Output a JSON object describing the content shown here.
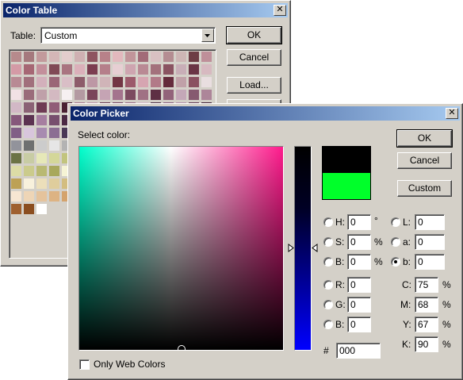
{
  "color_table": {
    "title": "Color Table",
    "table_label": "Table:",
    "table_value": "Custom",
    "buttons": {
      "ok": "OK",
      "cancel": "Cancel",
      "load": "Load..."
    },
    "swatches": [
      "#b68a8c",
      "#a5797d",
      "#c29a9c",
      "#d4b6b7",
      "#e3cdcd",
      "#cfb0b2",
      "#8e5560",
      "#b78189",
      "#e2b8bd",
      "#c1959a",
      "#a26b78",
      "#d8c0c2",
      "#b48d92",
      "#cdb6b5",
      "#6d3d45",
      "#bf8f99",
      "#d49aa6",
      "#a66774",
      "#c38f9b",
      "#804955",
      "#a97480",
      "#dbb0ba",
      "#7b3d50",
      "#b57f8a",
      "#e7cfd3",
      "#cea5b0",
      "#b98994",
      "#a3717c",
      "#8a5361",
      "#c8aeb7",
      "#6a3545",
      "#d7b9c0",
      "#b88a94",
      "#a1707c",
      "#d3b0bb",
      "#9a6677",
      "#d9bec6",
      "#8d5c6a",
      "#bd98a5",
      "#d0b4b8",
      "#733644",
      "#9c5a6b",
      "#d6a5b1",
      "#b27a88",
      "#652b3c",
      "#c0a1a8",
      "#8a5160",
      "#e9dee0",
      "#f2e1e5",
      "#9a6c7a",
      "#bfa0a9",
      "#d3b9c1",
      "#f6f0f1",
      "#b49aa2",
      "#7a455a",
      "#c5a4b4",
      "#a4748d",
      "#7c4b60",
      "#a07184",
      "#5e2f44",
      "#92637a",
      "#c4a8b8",
      "#865a70",
      "#ad8599",
      "#d2b8c6",
      "#8b6275",
      "#6e3b54",
      "#905e78",
      "#4a2133",
      "#a97c92",
      "#bd97ab",
      "#683a52",
      "#774764",
      "#9b6e89",
      "#d6bccb",
      "#503048",
      "#8a6181",
      "#b593ad",
      "#643c56",
      "#3f2035",
      "#86587b",
      "#5c3351",
      "#a67ea0",
      "#774f6e",
      "#4b2944",
      "#9b7597",
      "#cdb2c9",
      "#3d2133",
      "#6d4a66",
      "#b59ab3",
      "#523d53",
      "#755873",
      "#9a7f9b",
      "#6a4e6a",
      "#3b2540",
      "#56405c",
      "#815f86",
      "#d8c6dc",
      "#a88bb0",
      "#8b6e93",
      "#4a3857",
      "#6f5a7c",
      "#e5ddea",
      "#c0b3c8",
      "#4b4c7a",
      "#5a5c87",
      "#2f305c",
      "#7b7da4",
      "#a8a9c7",
      "#ecedf3",
      "#c4c5dc",
      "#363746",
      "#92939b",
      "#6f7070",
      "#cccccc",
      "#e6e6e6",
      "#b3b3b3",
      "#56673e",
      "#7a8c5c",
      "#000000",
      "#f3f5e8",
      "#d8dcc0",
      "#c7cb9f",
      "#a2a877",
      "#808842",
      "#eef0d8",
      "#b4b888",
      "#8e9463",
      "#6b7345",
      "#c8cca4",
      "#e6e8b8",
      "#d4d799",
      "#c2c47e",
      "#f1f2d3",
      "#dddfa8",
      "#cbce8b",
      "#b7b96d",
      "#a1a456",
      "#e9e9c0",
      "#d7d79f",
      "#c4c484",
      "#b0b068",
      "#9c9c52",
      "#eeeec6",
      "#dcdca6",
      "#cbcb8c",
      "#b9b973",
      "#a8a85c",
      "#f6f4d5",
      "#e8e5b5",
      "#d9d599",
      "#ccc77f",
      "#bfb967",
      "#fffde2",
      "#f1eec4",
      "#e3dfa8",
      "#f6ebce",
      "#e7d7a9",
      "#d9c48a",
      "#cbb26e",
      "#bda155",
      "#f8f1dc",
      "#ecdfba",
      "#dfcd9c",
      "#d3bd80",
      "#c6ac66",
      "#fff7e5",
      "#f3e7c4",
      "#e8d7a7",
      "#ffeedb",
      "#f7dfbf",
      "#efcfa4",
      "#e7bf8b",
      "#dfb075",
      "#ffffff",
      "#ffffff",
      "#f7e6d2",
      "#eed5b6",
      "#e5c39c",
      "#ddb383",
      "#d4a36c",
      "#cb9356",
      "#7a4a21",
      "#f1dcc4",
      "#e5c6a4",
      "#a85a1c",
      "#cc7c3d",
      "#e4a172",
      "#f5d8c2",
      "#fbe8da",
      "#c68a5c",
      "#b37443",
      "#9f602f",
      "#8b4e20",
      "#ffffff"
    ]
  },
  "color_picker": {
    "title": "Color Picker",
    "select_label": "Select color:",
    "buttons": {
      "ok": "OK",
      "cancel": "Cancel",
      "custom": "Custom"
    },
    "new_color": "#000000",
    "old_color": "#00ff2a",
    "fields": {
      "h": {
        "label": "H:",
        "value": "0",
        "unit": "°"
      },
      "s": {
        "label": "S:",
        "value": "0",
        "unit": "%"
      },
      "b_hsb": {
        "label": "B:",
        "value": "0",
        "unit": "%"
      },
      "r": {
        "label": "R:",
        "value": "0"
      },
      "g": {
        "label": "G:",
        "value": "0"
      },
      "b_rgb": {
        "label": "B:",
        "value": "0"
      },
      "l": {
        "label": "L:",
        "value": "0"
      },
      "a": {
        "label": "a:",
        "value": "0"
      },
      "b_lab": {
        "label": "b:",
        "value": "0"
      },
      "c": {
        "label": "C:",
        "value": "75",
        "unit": "%"
      },
      "m": {
        "label": "M:",
        "value": "68",
        "unit": "%"
      },
      "y": {
        "label": "Y:",
        "value": "67",
        "unit": "%"
      },
      "k": {
        "label": "K:",
        "value": "90",
        "unit": "%"
      }
    },
    "hex_label": "#",
    "hex_value": "000",
    "web_colors_label": "Only Web Colors",
    "selected_mode": "b_lab"
  }
}
